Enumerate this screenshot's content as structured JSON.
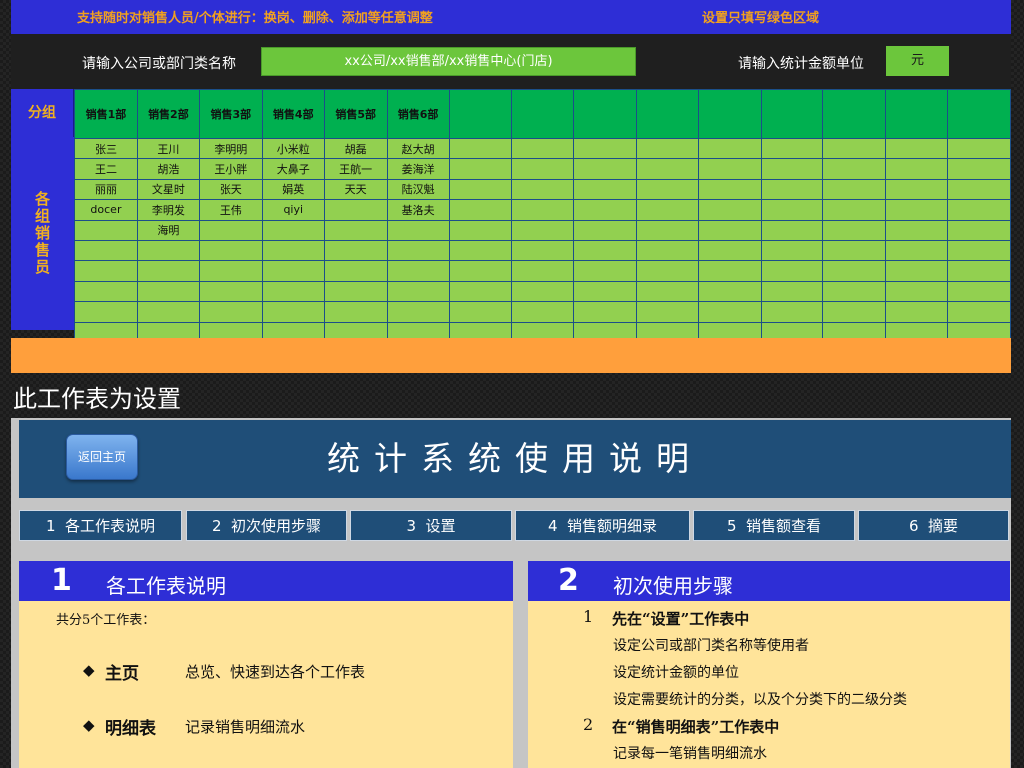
{
  "banner": {
    "left_text": "支持随时对销售人员/个体进行：换岗、删除、添加等任意调整",
    "right_text": "设置只填写绿色区域"
  },
  "settings": {
    "company_label": "请输入公司或部门类名称",
    "company_value": "xx公司/xx销售部/xx销售中心(门店)",
    "unit_label": "请输入统计金额单位",
    "unit_value": "元"
  },
  "grid": {
    "group_label": "分组",
    "side_label": "各组销售员",
    "headers": [
      "销售1部",
      "销售2部",
      "销售3部",
      "销售4部",
      "销售5部",
      "销售6部",
      "",
      "",
      "",
      "",
      "",
      "",
      "",
      "",
      ""
    ],
    "rows": [
      [
        "张三",
        "王川",
        "李明明",
        "小米粒",
        "胡磊",
        "赵大胡",
        "",
        "",
        "",
        "",
        "",
        "",
        "",
        "",
        ""
      ],
      [
        "王二",
        "胡浩",
        "王小胖",
        "大鼻子",
        "王航一",
        "姜海洋",
        "",
        "",
        "",
        "",
        "",
        "",
        "",
        "",
        ""
      ],
      [
        "丽丽",
        "文星时",
        "张天",
        "娟英",
        "天天",
        "陆汉魁",
        "",
        "",
        "",
        "",
        "",
        "",
        "",
        "",
        ""
      ],
      [
        "docer",
        "李明发",
        "王伟",
        "qiyi",
        "",
        "基洛夫",
        "",
        "",
        "",
        "",
        "",
        "",
        "",
        "",
        ""
      ],
      [
        "",
        "海明",
        "",
        "",
        "",
        "",
        "",
        "",
        "",
        "",
        "",
        "",
        "",
        "",
        ""
      ],
      [
        "",
        "",
        "",
        "",
        "",
        "",
        "",
        "",
        "",
        "",
        "",
        "",
        "",
        "",
        ""
      ],
      [
        "",
        "",
        "",
        "",
        "",
        "",
        "",
        "",
        "",
        "",
        "",
        "",
        "",
        "",
        ""
      ],
      [
        "",
        "",
        "",
        "",
        "",
        "",
        "",
        "",
        "",
        "",
        "",
        "",
        "",
        "",
        ""
      ],
      [
        "",
        "",
        "",
        "",
        "",
        "",
        "",
        "",
        "",
        "",
        "",
        "",
        "",
        "",
        ""
      ],
      [
        "",
        "",
        "",
        "",
        "",
        "",
        "",
        "",
        "",
        "",
        "",
        "",
        "",
        "",
        ""
      ]
    ]
  },
  "caption": "此工作表为设置",
  "manual": {
    "home_button": "返回主页",
    "title": "统计系统使用说明",
    "tabs": [
      {
        "num": "1",
        "label": "各工作表说明"
      },
      {
        "num": "2",
        "label": "初次使用步骤"
      },
      {
        "num": "3",
        "label": "设置"
      },
      {
        "num": "4",
        "label": "销售额明细录"
      },
      {
        "num": "5",
        "label": "销售额查看"
      },
      {
        "num": "6",
        "label": "摘要"
      }
    ],
    "section1": {
      "num": "1",
      "title": "各工作表说明",
      "intro": "共分5个工作表：",
      "items": [
        {
          "name": "主页",
          "desc": "总览、快速到达各个工作表"
        },
        {
          "name": "明细表",
          "desc": "记录销售明细流水"
        }
      ]
    },
    "section2": {
      "num": "2",
      "title": "初次使用步骤",
      "steps": [
        {
          "num": "1",
          "title": "先在“设置”工作表中",
          "lines": [
            "设定公司或部门类名称等使用者",
            "设定统计金额的单位",
            "设定需要统计的分类，以及个分类下的二级分类"
          ]
        },
        {
          "num": "2",
          "title": "在“销售明细表”工作表中",
          "lines": [
            "记录每一笔销售明细流水"
          ]
        }
      ]
    }
  },
  "colors": {
    "banner_blue": "#2e2ed6",
    "header_green": "#00b050",
    "cell_green": "#92d050",
    "orange": "#ff9f3c",
    "manual_navy": "#1f4e78",
    "card_yellow": "#ffe49a"
  },
  "icons": [
    "diamond-bullet-icon"
  ]
}
